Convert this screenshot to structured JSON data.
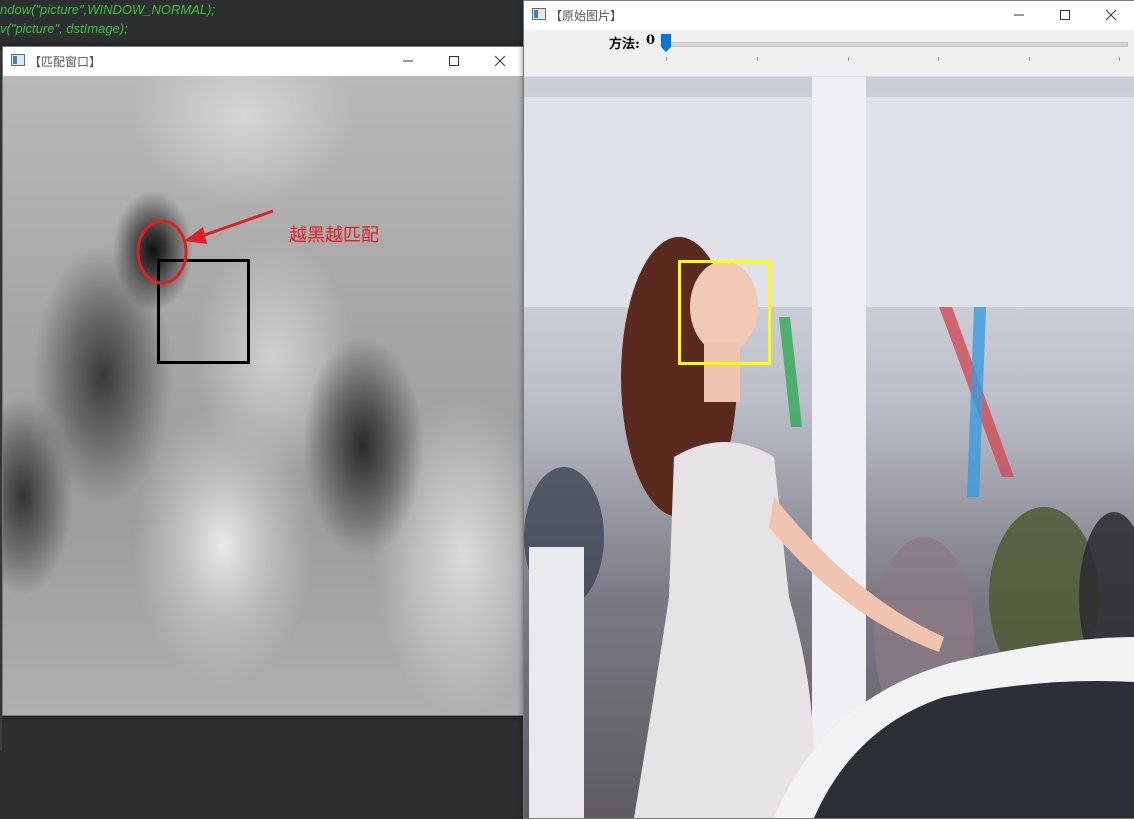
{
  "editor": {
    "lines": [
      "ndow(\"picture\",WINDOW_NORMAL);",
      "v(\"picture\", dstImage);"
    ]
  },
  "match_window": {
    "title": "【匹配窗口】",
    "annotation": "越黑越匹配",
    "icons": [
      "window-icon",
      "minimize-icon",
      "maximize-icon",
      "close-icon"
    ],
    "colors": {
      "annotation": "#e02020",
      "match_rect": "#000000"
    }
  },
  "original_window": {
    "title": "【原始图片】",
    "trackbar": {
      "label": "方法:",
      "value": "0",
      "min": 0,
      "max": 5
    },
    "icons": [
      "window-icon",
      "minimize-icon",
      "maximize-icon",
      "close-icon"
    ],
    "colors": {
      "face_rect": "#ffff00",
      "slider_thumb": "#0078d7"
    }
  }
}
